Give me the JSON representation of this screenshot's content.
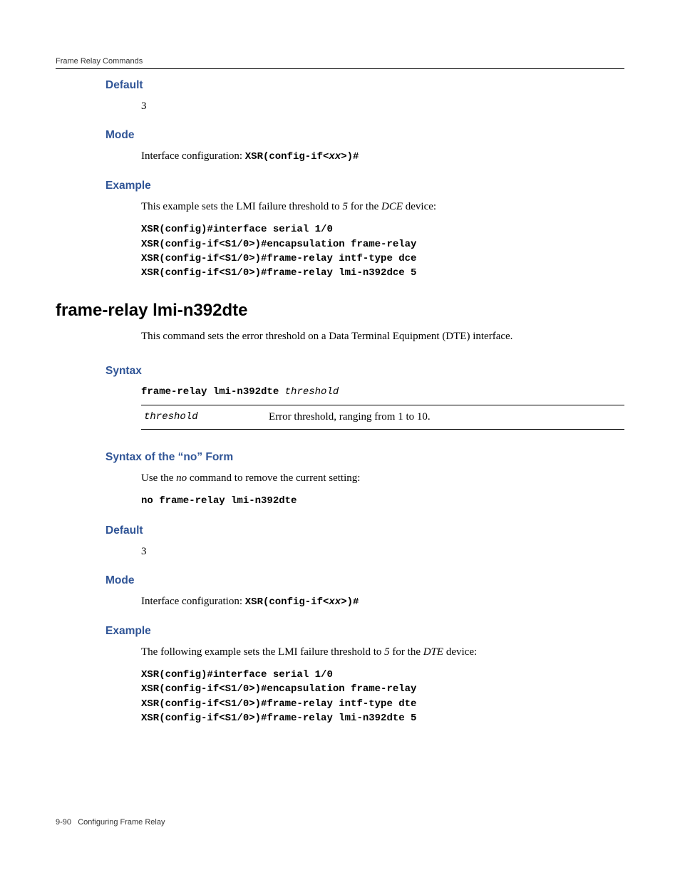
{
  "header": {
    "chapter": "Frame Relay Commands"
  },
  "sec1": {
    "default": {
      "title": "Default",
      "value": "3"
    },
    "mode": {
      "title": "Mode",
      "lead": "Interface configuration: ",
      "prompt1": "XSR(config-if<",
      "var": "xx",
      "prompt2": ">)#"
    },
    "example": {
      "title": "Example",
      "lead1": "This example sets the LMI failure threshold to ",
      "val": "5",
      "lead2": " for the ",
      "dev": "DCE",
      "lead3": " device:",
      "code": "XSR(config)#interface serial 1/0\nXSR(config-if<S1/0>)#encapsulation frame-relay\nXSR(config-if<S1/0>)#frame-relay intf-type dce\nXSR(config-if<S1/0>)#frame-relay lmi-n392dce 5"
    }
  },
  "mainHeading": "frame-relay lmi-n392dte",
  "mainDesc": "This command sets the error threshold on a Data Terminal Equipment (DTE) interface.",
  "syntax": {
    "title": "Syntax",
    "cmd": "frame-relay lmi-n392dte ",
    "arg": "threshold",
    "tableArg": "threshold",
    "tableDesc": "Error threshold, ranging from 1 to 10."
  },
  "noform": {
    "title": "Syntax of the “no” Form",
    "lead1": "Use the ",
    "no": "no",
    "lead2": " command to remove the current setting:",
    "code": "no frame-relay lmi-n392dte"
  },
  "sec2": {
    "default": {
      "title": "Default",
      "value": "3"
    },
    "mode": {
      "title": "Mode",
      "lead": "Interface configuration: ",
      "prompt1": "XSR(config-if<",
      "var": "xx",
      "prompt2": ">)#"
    },
    "example": {
      "title": "Example",
      "lead1": "The following example sets the LMI failure threshold to ",
      "val": "5",
      "lead2": " for the ",
      "dev": "DTE",
      "lead3": " device:",
      "code": "XSR(config)#interface serial 1/0\nXSR(config-if<S1/0>)#encapsulation frame-relay\nXSR(config-if<S1/0>)#frame-relay intf-type dte\nXSR(config-if<S1/0>)#frame-relay lmi-n392dte 5"
    }
  },
  "footer": {
    "pageNum": "9-90",
    "chapter": "Configuring Frame Relay"
  }
}
